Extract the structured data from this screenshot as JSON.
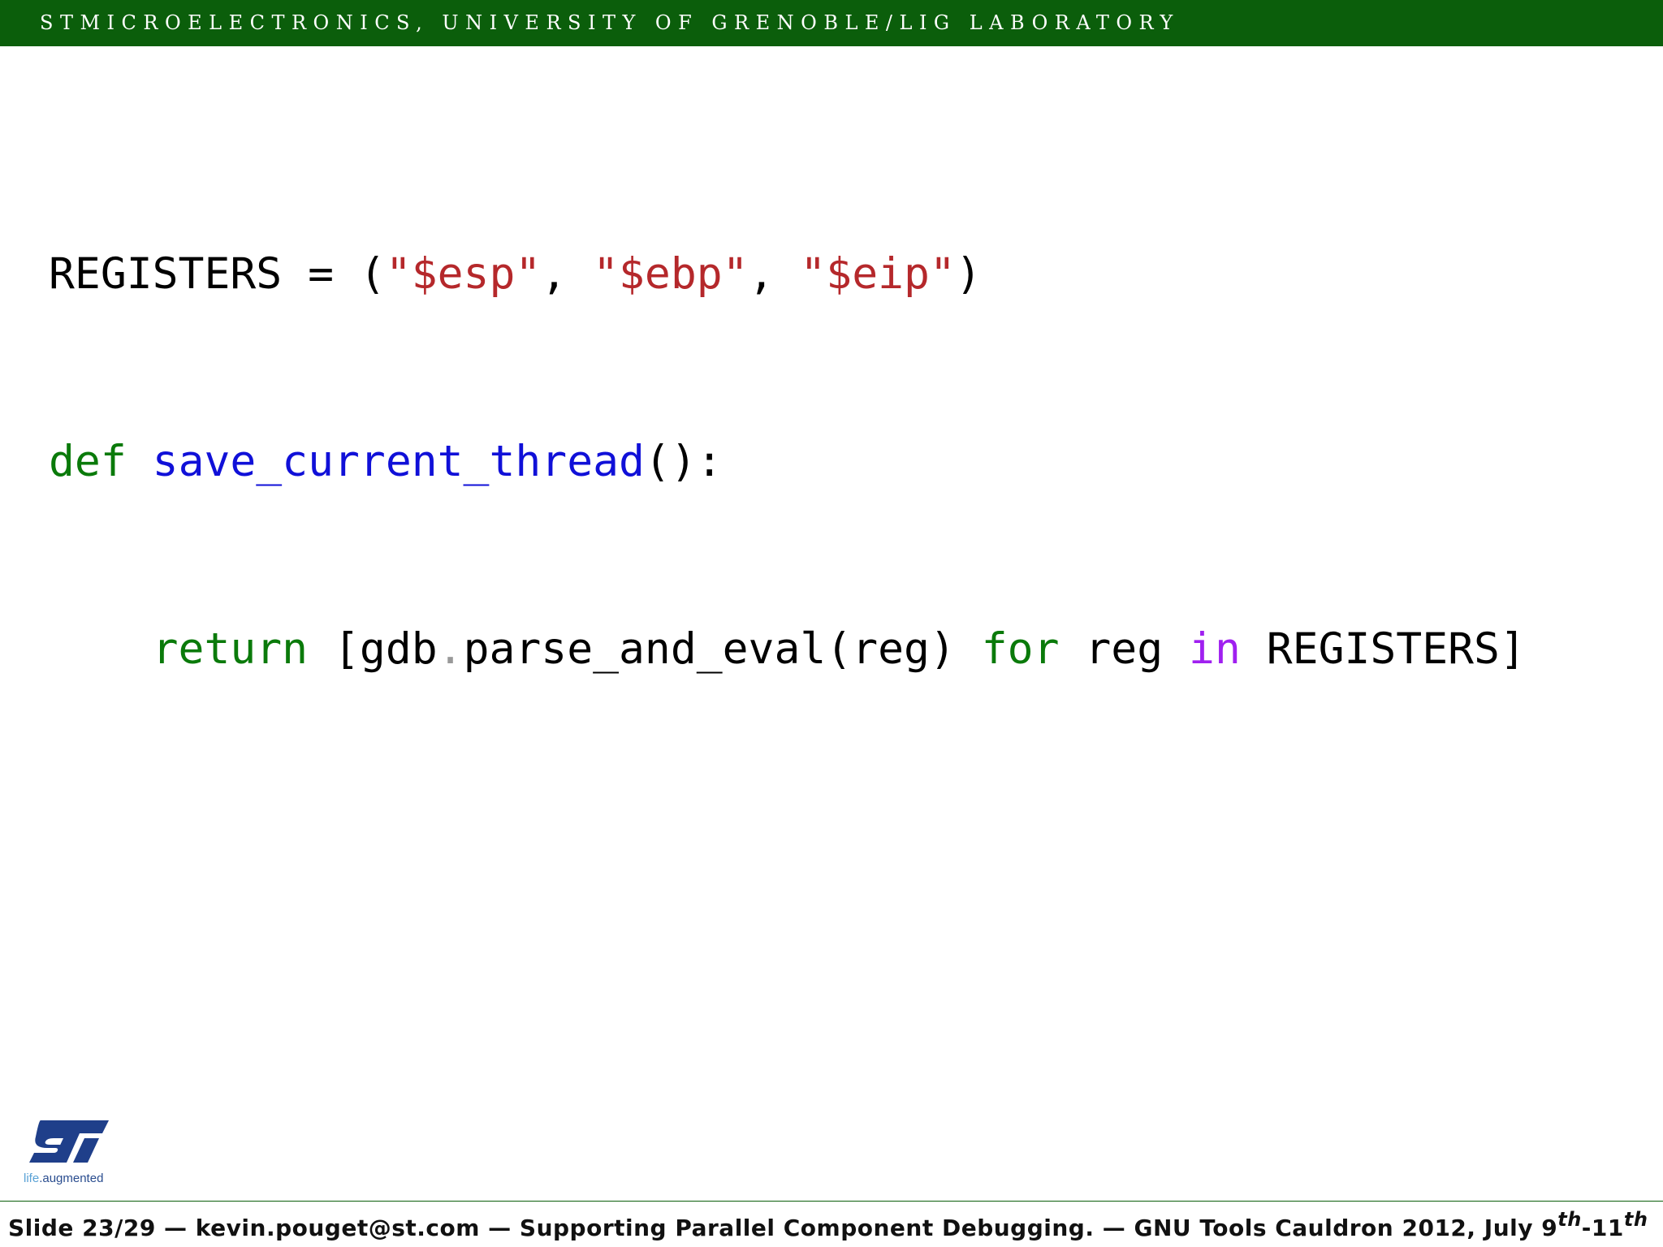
{
  "header": {
    "text": "STMicroelectronics, University of Grenoble/LIG laboratory"
  },
  "code": {
    "line1": {
      "name": "REGISTERS",
      "eq": " = (",
      "s1": "\"$esp\"",
      "c1": ", ",
      "s2": "\"$ebp\"",
      "c2": ", ",
      "s3": "\"$eip\"",
      "close": ")"
    },
    "line2": {
      "kw": "def",
      "space": " ",
      "fn": "save_current_thread",
      "rest": "():"
    },
    "line3": {
      "indent": "    ",
      "kw_return": "return",
      "p1": " [gdb",
      "dot": ".",
      "p2": "parse_and_eval(reg) ",
      "kw_for": "for",
      "p3": " reg ",
      "kw_in": "in",
      "p4": " REGISTERS]"
    }
  },
  "logo": {
    "life": "life",
    "augmented": ".augmented",
    "icon_name": "st-logo"
  },
  "footer": {
    "main": "Slide 23/29 — kevin.pouget@st.com — Supporting Parallel Component Debugging. — GNU Tools Cauldron 2012, July 9",
    "sup1": "th",
    "mid": "-11",
    "sup2": "th"
  },
  "colors": {
    "header_bg": "#0b5e0b",
    "keyword": "#0a7a0a",
    "string": "#b5282b",
    "function": "#1010d8",
    "in_operator": "#a020f0"
  }
}
